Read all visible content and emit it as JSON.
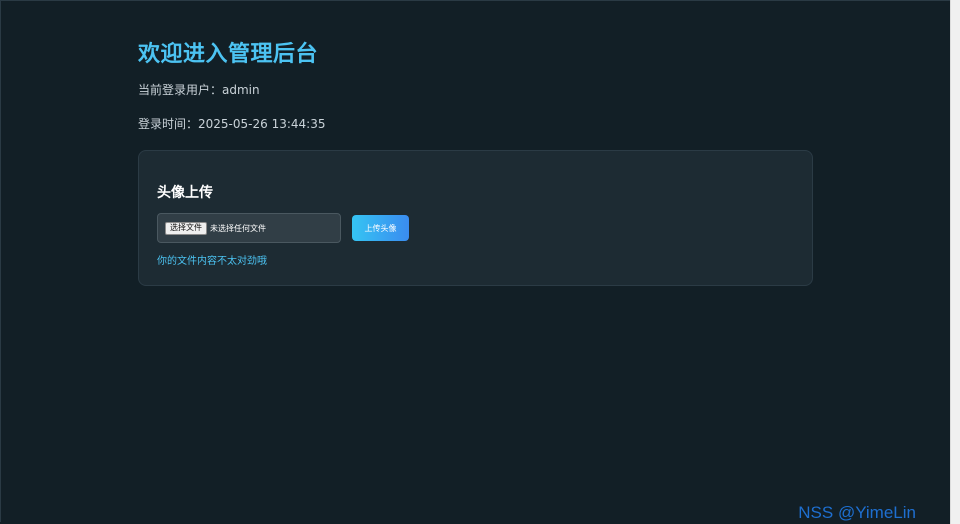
{
  "header": {
    "title": "欢迎进入管理后台",
    "current_user_label": "当前登录用户：",
    "current_user": "admin",
    "login_time_label": "登录时间：",
    "login_time": "2025-05-26 13:44:35"
  },
  "upload_card": {
    "title": "头像上传",
    "choose_file_label": "选择文件",
    "no_file_text": "未选择任何文件",
    "upload_button_label": "上传头像",
    "message": "你的文件内容不太对劲哦"
  },
  "watermark": {
    "text": "NSS @YimeLin"
  },
  "colors": {
    "background": "#121f26",
    "card": "#1d2b33",
    "accent": "#4cc3f2",
    "button_gradient_start": "#35c4f3",
    "button_gradient_end": "#3a8cf0",
    "watermark": "#1e6fd0"
  }
}
